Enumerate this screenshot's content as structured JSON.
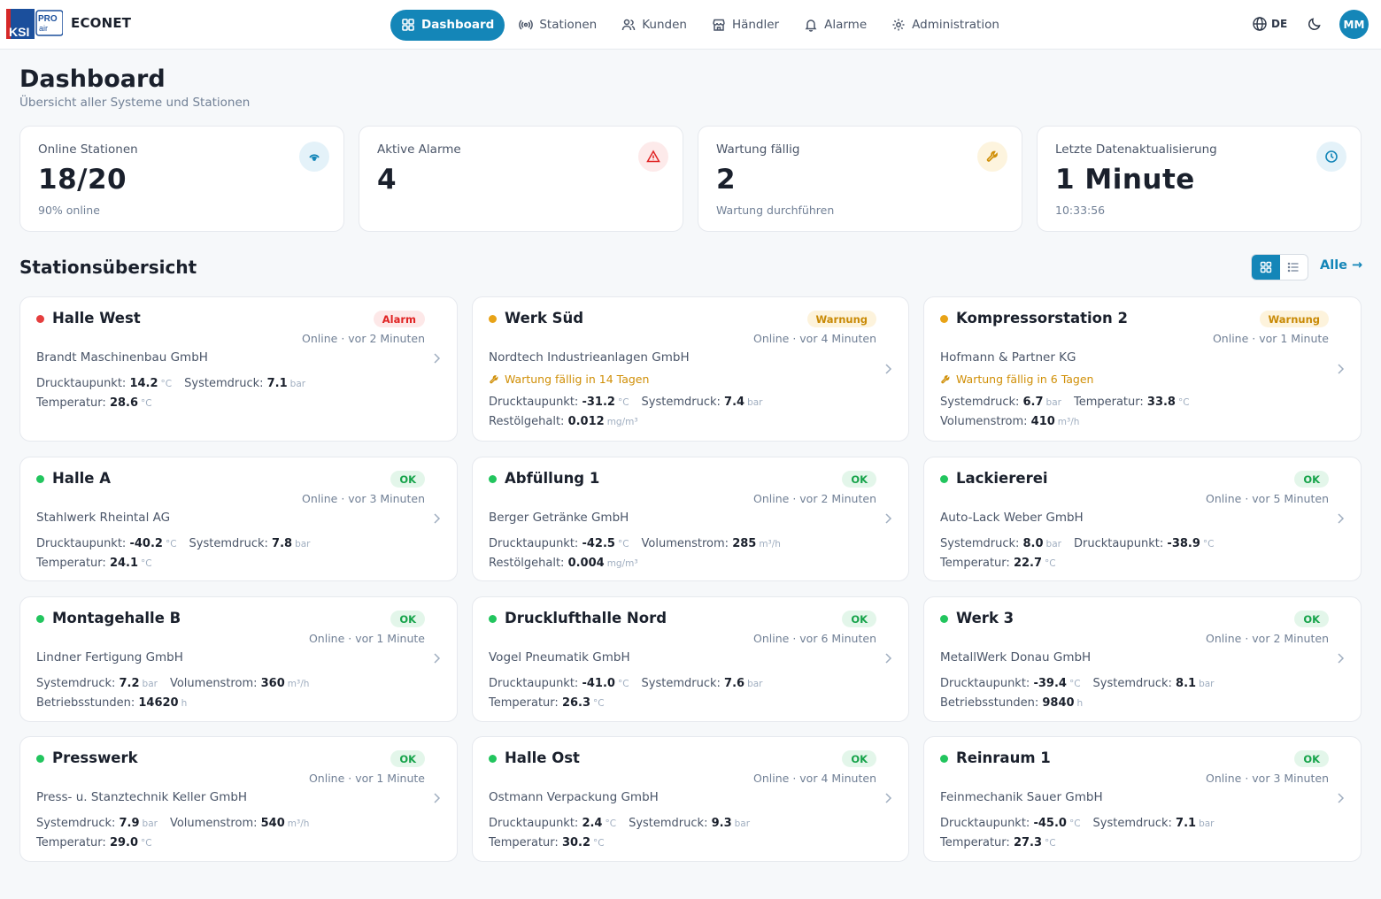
{
  "app": {
    "logo_text_top": "PRO",
    "logo_text_sub": "air",
    "logo_text_ksi": "KSI",
    "brand": "ECONET"
  },
  "nav": {
    "dashboard": "Dashboard",
    "stationen": "Stationen",
    "kunden": "Kunden",
    "haendler": "Händler",
    "alarme": "Alarme",
    "administration": "Administration"
  },
  "header": {
    "language": "DE",
    "avatar_initials": "MM"
  },
  "page": {
    "title": "Dashboard",
    "subtitle": "Übersicht aller Systeme und Stationen"
  },
  "stats": [
    {
      "label": "Online Stationen",
      "value": "18/20",
      "sub": "90% online",
      "icon": "signal-icon",
      "color": "#1486b8"
    },
    {
      "label": "Aktive Alarme",
      "value": "4",
      "sub": "",
      "icon": "warning-icon",
      "color": "#e02424"
    },
    {
      "label": "Wartung fällig",
      "value": "2",
      "sub": "Wartung durchführen",
      "icon": "wrench-icon",
      "color": "#d08f07"
    },
    {
      "label": "Letzte Datenaktualisierung",
      "value": "1 Minute",
      "sub": "10:33:56",
      "icon": "clock-icon",
      "color": "#1486b8"
    }
  ],
  "section": {
    "title": "Stationsübersicht",
    "all_link": "Alle →"
  },
  "colors": {
    "accent": "#1486b8",
    "alarm": "#e53e3e",
    "warning": "#e8a317",
    "ok": "#22c55e"
  },
  "stations": [
    {
      "name": "Halle West",
      "status": "alarm",
      "badge": "Alarm",
      "online": "Online · vor 2 Minuten",
      "company": "Brandt Maschinenbau GmbH",
      "maintenance": "",
      "rows": [
        [
          {
            "label": "Drucktaupunkt:",
            "value": "14.2",
            "unit": "°C"
          },
          {
            "label": "Systemdruck:",
            "value": "7.1",
            "unit": "bar"
          }
        ],
        [
          {
            "label": "Temperatur:",
            "value": "28.6",
            "unit": "°C"
          }
        ]
      ]
    },
    {
      "name": "Werk Süd",
      "status": "warn",
      "badge": "Warnung",
      "online": "Online · vor 4 Minuten",
      "company": "Nordtech Industrieanlagen GmbH",
      "maintenance": "Wartung fällig in 14 Tagen",
      "rows": [
        [
          {
            "label": "Drucktaupunkt:",
            "value": "-31.2",
            "unit": "°C"
          },
          {
            "label": "Systemdruck:",
            "value": "7.4",
            "unit": "bar"
          }
        ],
        [
          {
            "label": "Restölgehalt:",
            "value": "0.012",
            "unit": "mg/m³"
          }
        ]
      ]
    },
    {
      "name": "Kompressorstation 2",
      "status": "warn",
      "badge": "Warnung",
      "online": "Online · vor 1 Minute",
      "company": "Hofmann & Partner KG",
      "maintenance": "Wartung fällig in 6 Tagen",
      "rows": [
        [
          {
            "label": "Systemdruck:",
            "value": "6.7",
            "unit": "bar"
          },
          {
            "label": "Temperatur:",
            "value": "33.8",
            "unit": "°C"
          }
        ],
        [
          {
            "label": "Volumenstrom:",
            "value": "410",
            "unit": "m³/h"
          }
        ]
      ]
    },
    {
      "name": "Halle A",
      "status": "ok",
      "badge": "OK",
      "online": "Online · vor 3 Minuten",
      "company": "Stahlwerk Rheintal AG",
      "maintenance": "",
      "rows": [
        [
          {
            "label": "Drucktaupunkt:",
            "value": "-40.2",
            "unit": "°C"
          },
          {
            "label": "Systemdruck:",
            "value": "7.8",
            "unit": "bar"
          }
        ],
        [
          {
            "label": "Temperatur:",
            "value": "24.1",
            "unit": "°C"
          }
        ]
      ]
    },
    {
      "name": "Abfüllung 1",
      "status": "ok",
      "badge": "OK",
      "online": "Online · vor 2 Minuten",
      "company": "Berger Getränke GmbH",
      "maintenance": "",
      "rows": [
        [
          {
            "label": "Drucktaupunkt:",
            "value": "-42.5",
            "unit": "°C"
          },
          {
            "label": "Volumenstrom:",
            "value": "285",
            "unit": "m³/h"
          }
        ],
        [
          {
            "label": "Restölgehalt:",
            "value": "0.004",
            "unit": "mg/m³"
          }
        ]
      ]
    },
    {
      "name": "Lackiererei",
      "status": "ok",
      "badge": "OK",
      "online": "Online · vor 5 Minuten",
      "company": "Auto-Lack Weber GmbH",
      "maintenance": "",
      "rows": [
        [
          {
            "label": "Systemdruck:",
            "value": "8.0",
            "unit": "bar"
          },
          {
            "label": "Drucktaupunkt:",
            "value": "-38.9",
            "unit": "°C"
          }
        ],
        [
          {
            "label": "Temperatur:",
            "value": "22.7",
            "unit": "°C"
          }
        ]
      ]
    },
    {
      "name": "Montagehalle B",
      "status": "ok",
      "badge": "OK",
      "online": "Online · vor 1 Minute",
      "company": "Lindner Fertigung GmbH",
      "maintenance": "",
      "rows": [
        [
          {
            "label": "Systemdruck:",
            "value": "7.2",
            "unit": "bar"
          },
          {
            "label": "Volumenstrom:",
            "value": "360",
            "unit": "m³/h"
          }
        ],
        [
          {
            "label": "Betriebsstunden:",
            "value": "14620",
            "unit": "h"
          }
        ]
      ]
    },
    {
      "name": "Drucklufthalle Nord",
      "status": "ok",
      "badge": "OK",
      "online": "Online · vor 6 Minuten",
      "company": "Vogel Pneumatik GmbH",
      "maintenance": "",
      "rows": [
        [
          {
            "label": "Drucktaupunkt:",
            "value": "-41.0",
            "unit": "°C"
          },
          {
            "label": "Systemdruck:",
            "value": "7.6",
            "unit": "bar"
          }
        ],
        [
          {
            "label": "Temperatur:",
            "value": "26.3",
            "unit": "°C"
          }
        ]
      ]
    },
    {
      "name": "Werk 3",
      "status": "ok",
      "badge": "OK",
      "online": "Online · vor 2 Minuten",
      "company": "MetallWerk Donau GmbH",
      "maintenance": "",
      "rows": [
        [
          {
            "label": "Drucktaupunkt:",
            "value": "-39.4",
            "unit": "°C"
          },
          {
            "label": "Systemdruck:",
            "value": "8.1",
            "unit": "bar"
          }
        ],
        [
          {
            "label": "Betriebsstunden:",
            "value": "9840",
            "unit": "h"
          }
        ]
      ]
    },
    {
      "name": "Presswerk",
      "status": "ok",
      "badge": "OK",
      "online": "Online · vor 1 Minute",
      "company": "Press- u. Stanztechnik Keller GmbH",
      "maintenance": "",
      "rows": [
        [
          {
            "label": "Systemdruck:",
            "value": "7.9",
            "unit": "bar"
          },
          {
            "label": "Volumenstrom:",
            "value": "540",
            "unit": "m³/h"
          }
        ],
        [
          {
            "label": "Temperatur:",
            "value": "29.0",
            "unit": "°C"
          }
        ]
      ]
    },
    {
      "name": "Halle Ost",
      "status": "ok",
      "badge": "OK",
      "online": "Online · vor 4 Minuten",
      "company": "Ostmann Verpackung GmbH",
      "maintenance": "",
      "rows": [
        [
          {
            "label": "Drucktaupunkt:",
            "value": "2.4",
            "unit": "°C"
          },
          {
            "label": "Systemdruck:",
            "value": "9.3",
            "unit": "bar"
          }
        ],
        [
          {
            "label": "Temperatur:",
            "value": "30.2",
            "unit": "°C"
          }
        ]
      ]
    },
    {
      "name": "Reinraum 1",
      "status": "ok",
      "badge": "OK",
      "online": "Online · vor 3 Minuten",
      "company": "Feinmechanik Sauer GmbH",
      "maintenance": "",
      "rows": [
        [
          {
            "label": "Drucktaupunkt:",
            "value": "-45.0",
            "unit": "°C"
          },
          {
            "label": "Systemdruck:",
            "value": "7.1",
            "unit": "bar"
          }
        ],
        [
          {
            "label": "Temperatur:",
            "value": "27.3",
            "unit": "°C"
          }
        ]
      ]
    }
  ]
}
